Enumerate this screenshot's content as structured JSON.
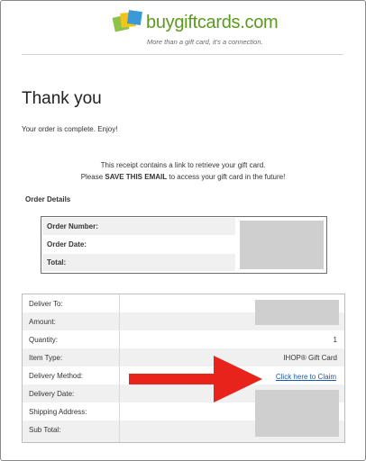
{
  "header": {
    "brand": "buygiftcards.com",
    "tagline": "More than a gift card, it's a connection."
  },
  "main": {
    "heading": "Thank you",
    "complete": "Your order is complete. Enjoy!",
    "receipt_line1": "This receipt contains a link to retrieve your gift card.",
    "receipt_line2_pre": "Please ",
    "receipt_line2_bold": "SAVE THIS EMAIL",
    "receipt_line2_post": " to access your gift card in the future!",
    "order_details_title": "Order Details"
  },
  "order_details": {
    "rows": [
      {
        "label": "Order Number:"
      },
      {
        "label": "Order Date:"
      },
      {
        "label": "Total:"
      }
    ]
  },
  "details_table": {
    "rows": [
      {
        "label": "Deliver To:",
        "value": ""
      },
      {
        "label": "Amount:",
        "value": ""
      },
      {
        "label": "Quantity:",
        "value": "1"
      },
      {
        "label": "Item Type:",
        "value": "IHOP® Gift Card"
      },
      {
        "label": "Delivery Method:",
        "value": "Click here to Claim"
      },
      {
        "label": "Delivery Date:",
        "value": ""
      },
      {
        "label": "Shipping Address:",
        "value": ""
      },
      {
        "label": "Sub Total:",
        "value": ""
      }
    ]
  },
  "colors": {
    "brand_green": "#5a9a1e",
    "link_blue": "#1b5aa8",
    "arrow_red": "#e8231b",
    "row_shade": "#f0f0f0",
    "redaction": "#cfcfcf"
  },
  "icons": {
    "logo": "gift-cards-logo-icon",
    "arrow": "red-arrow-icon"
  }
}
